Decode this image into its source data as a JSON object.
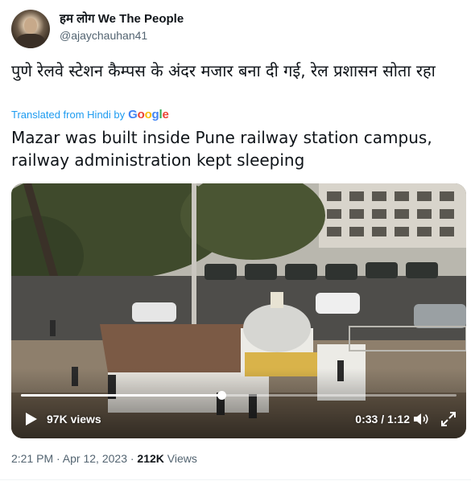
{
  "author": {
    "name": "हम लोग We The People",
    "handle": "@ajaychauhan41"
  },
  "tweet": {
    "text_original": "पुणे रेलवे स्टेशन कैम्पस के अंदर मजार बना दी गई, रेल प्रशासन सोता रहा",
    "translated_label": "Translated from Hindi by",
    "translator": "Google",
    "text_translated": "Mazar was built inside Pune railway station campus, railway administration kept sleeping"
  },
  "video": {
    "views": "97K views",
    "time": "0:33 / 1:12",
    "progress": 0.46,
    "icons": {
      "play": "play-icon",
      "volume": "volume-icon",
      "fullscreen": "fullscreen-icon"
    }
  },
  "meta": {
    "timestamp": "2:21 PM · Apr 12, 2023 · ",
    "view_count": "212K",
    "view_label": " Views"
  },
  "colors": {
    "link": "#1d9bf0",
    "secondary_text": "#536471"
  }
}
